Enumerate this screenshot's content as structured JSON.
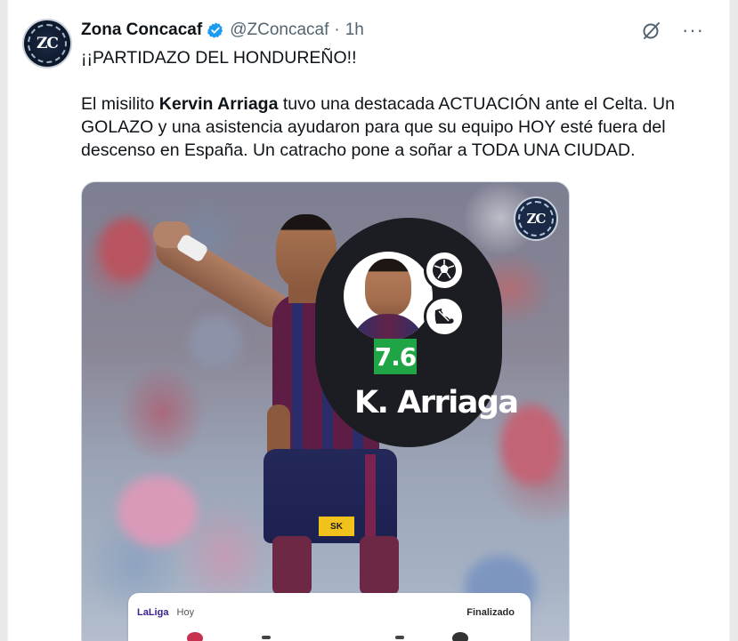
{
  "tweet": {
    "author_name": "Zona Concacaf",
    "handle": "@ZConcacaf",
    "separator": "·",
    "time": "1h",
    "avatar_text": "ZC",
    "more_icon": "···",
    "text": {
      "line1": "¡¡PARTIDAZO DEL HONDUREÑO!!",
      "p2_before": "El misilito ",
      "p2_bold": "Kervin Arriaga",
      "p2_after": " tuvo una destacada ACTUACIÓN ante el Celta. Un GOLAZO y una asistencia ayudaron para que su equipo HOY esté fuera del descenso en España. Un catracho pone a soñar a TODA UNA CIUDAD."
    }
  },
  "media": {
    "logo_text": "ZC",
    "rating": "7.6",
    "player_name": "K. Arriaga",
    "sponsor": "SK",
    "stat_icons": [
      "ball-icon",
      "boot-icon"
    ],
    "score_card": {
      "league": "LaLiga",
      "day": "Hoy",
      "status": "Finalizado"
    }
  },
  "colors": {
    "verified": "#1d9bf0",
    "rating_bg": "#1fa546",
    "card_bg": "#1b1d22",
    "muted_text": "#536471"
  }
}
